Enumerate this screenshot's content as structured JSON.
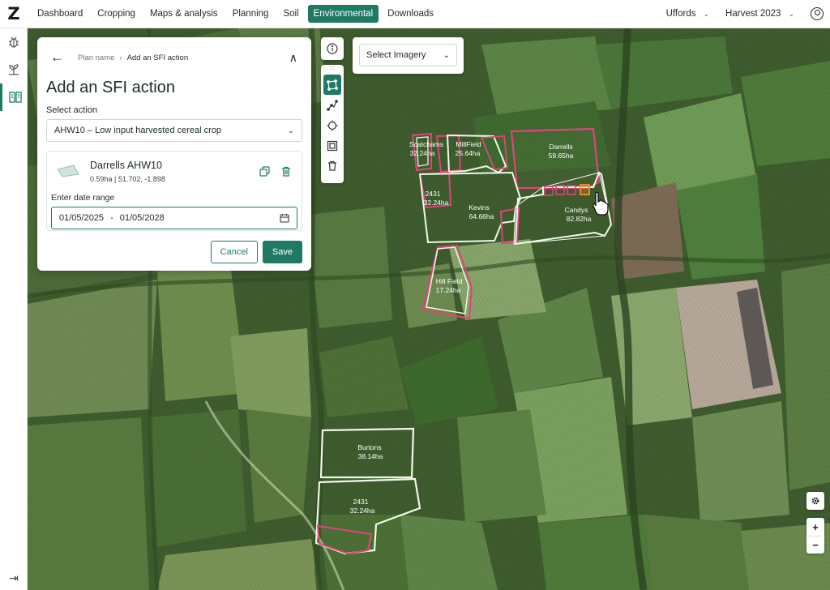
{
  "logo": "Z",
  "nav": {
    "items": [
      "Dashboard",
      "Cropping",
      "Maps & analysis",
      "Planning",
      "Soil",
      "Environmental",
      "Downloads"
    ],
    "active": "Environmental"
  },
  "top_right": {
    "farm": "Uffords",
    "season": "Harvest 2023"
  },
  "panel": {
    "breadcrumb_parent": "Plan name",
    "breadcrumb_current": "Add an SFI action",
    "title": "Add an SFI action",
    "select_action_label": "Select action",
    "selected_action": "AHW10 – Low input harvested cereal crop",
    "field_card": {
      "name": "Darrells AHW10",
      "meta": "0.59ha | 51.702, -1.898"
    },
    "date_range_label": "Enter date range",
    "date_from": "01/05/2025",
    "date_sep": "-",
    "date_to": "01/05/2028",
    "cancel_label": "Cancel",
    "save_label": "Save"
  },
  "imagery": {
    "placeholder": "Select Imagery"
  },
  "map_controls": {
    "zoom_in": "+",
    "zoom_out": "−"
  },
  "fields": [
    {
      "name": "Scatchams",
      "area": "32.24ha"
    },
    {
      "name": "MillField",
      "area": "25.64ha"
    },
    {
      "name": "Darrells",
      "area": "59.65ha"
    },
    {
      "name": "2431",
      "area": "32.24ha"
    },
    {
      "name": "Kevins",
      "area": "64.66ha"
    },
    {
      "name": "Candys",
      "area": "82.82ha"
    },
    {
      "name": "Hill Field",
      "area": "17.24ha"
    },
    {
      "name": "Burtons",
      "area": "38.14ha"
    },
    {
      "name": "2431",
      "area": "32.24ha"
    }
  ],
  "colors": {
    "brand": "#1f7a64",
    "field_outline": "#f2f8e8",
    "sfi_outline": "#e0447c",
    "selected_outline": "#f08a24"
  },
  "icons": {
    "rail": [
      "bug-icon",
      "seedling-icon",
      "environmental-icon"
    ],
    "rail_bottom": "expand-sidebar-icon",
    "tools": [
      "drag-handle-icon",
      "select-polygon-icon",
      "draw-line-icon",
      "crosshair-icon",
      "square-icon",
      "trash-icon"
    ]
  }
}
